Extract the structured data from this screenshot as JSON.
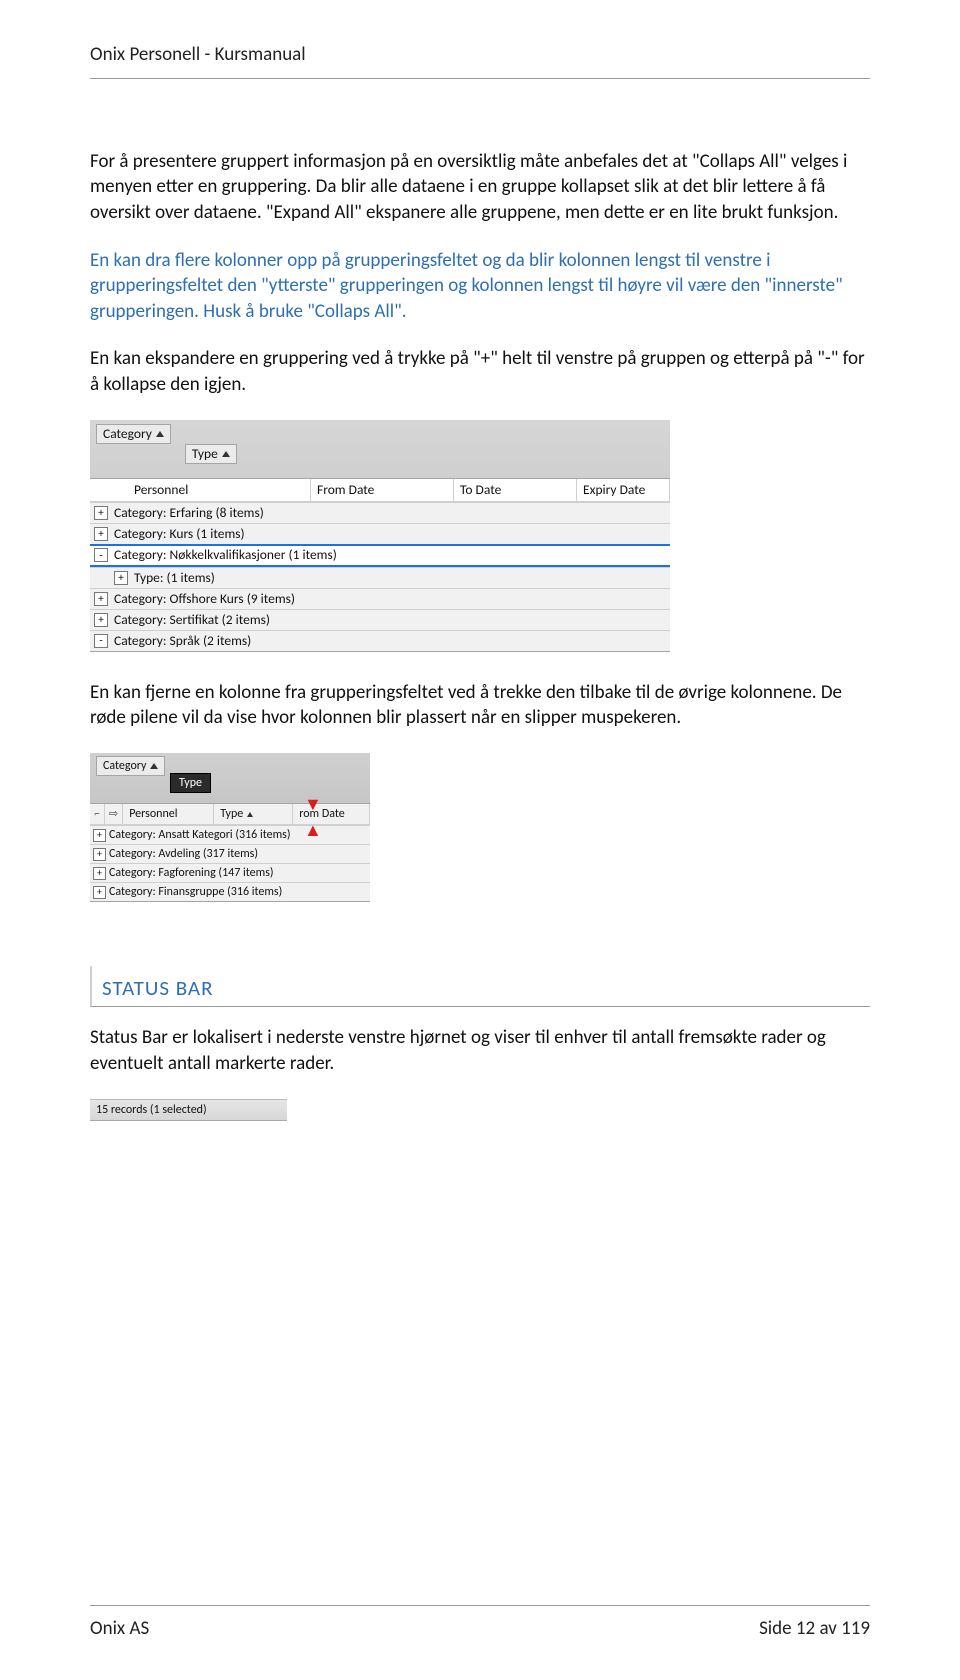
{
  "header": {
    "title": "Onix Personell - Kursmanual"
  },
  "body": {
    "p1": "For å presentere gruppert informasjon på en oversiktlig måte anbefales det at \"Collaps All\" velges i menyen etter en gruppering. Da blir alle dataene i en gruppe kollapset slik at det blir lettere å få oversikt over dataene. \"Expand All\" ekspanere alle gruppene, men dette er en lite brukt funksjon.",
    "p2": "En kan dra flere kolonner opp på grupperingsfeltet og da blir kolonnen lengst til venstre i grupperingsfeltet den \"ytterste\" grupperingen og kolonnen lengst til høyre vil være den \"innerste\" grupperingen. Husk å bruke \"Collaps All\".",
    "p3": "En kan ekspandere en gruppering ved å trykke på \"+\" helt til venstre på gruppen og etterpå på \"-\" for å kollapse den igjen.",
    "p4": "En kan fjerne en kolonne fra grupperingsfeltet ved å trekke den tilbake til de øvrige kolonnene. De røde pilene vil da vise hvor kolonnen blir plassert når en slipper muspekeren.",
    "sec_heading": "STATUS BAR",
    "p5": "Status Bar er lokalisert i nederste venstre hjørnet og viser til enhver til antall fremsøkte rader og eventuelt antall markerte rader."
  },
  "shot1": {
    "groupChips": [
      "Category",
      "Type"
    ],
    "columns": [
      "Personnel",
      "From Date",
      "To Date",
      "Expiry Date"
    ],
    "rows": [
      {
        "sign": "+",
        "text": "Category:  Erfaring (8 items)",
        "indent": 0
      },
      {
        "sign": "+",
        "text": "Category:  Kurs (1 items)",
        "indent": 0
      },
      {
        "sign": "-",
        "text": "Category:  Nøkkelkvalifikasjoner (1 items)",
        "indent": 0,
        "selected": true
      },
      {
        "sign": "+",
        "text": "Type:   (1 items)",
        "indent": 1
      },
      {
        "sign": "+",
        "text": "Category:  Offshore Kurs (9 items)",
        "indent": 0
      },
      {
        "sign": "+",
        "text": "Category:  Sertifikat (2 items)",
        "indent": 0
      },
      {
        "sign": "-",
        "text": "Category:  Språk (2 items)",
        "indent": 0
      }
    ]
  },
  "shot2": {
    "chip1": "Category",
    "chipDrag": "Type",
    "headers": {
      "personnel": "Personnel",
      "type": "Type",
      "rom": "rom Date"
    },
    "rows": [
      "Category:  Ansatt Kategori (316 items)",
      "Category:  Avdeling (317 items)",
      "Category:  Fagforening (147 items)",
      "Category:  Finansgruppe (316 items)"
    ]
  },
  "shot3": {
    "text": "15 records (1 selected)"
  },
  "footer": {
    "left": "Onix AS",
    "right": "Side 12 av 119"
  }
}
